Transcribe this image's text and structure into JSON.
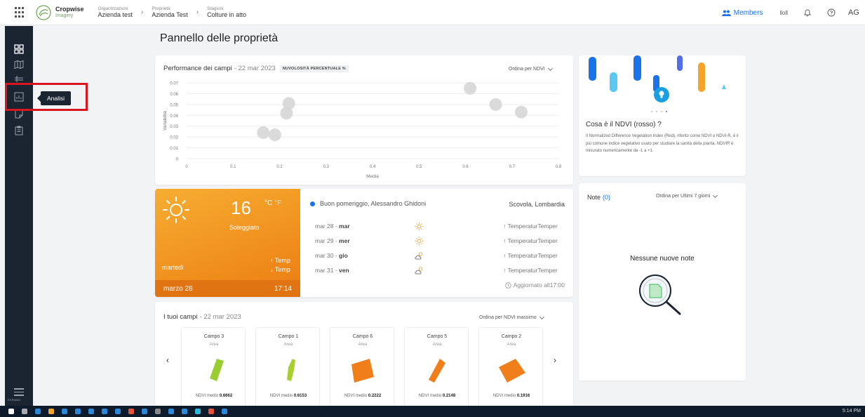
{
  "app": {
    "brand": "Cropwise",
    "product": "Imagery"
  },
  "breadcrumb": [
    {
      "key": "Organizzazioni",
      "value": "Azienda test"
    },
    {
      "key": "Proprietà",
      "value": "Azienda Test"
    },
    {
      "key": "Stagioni",
      "value": "Colture in atto"
    }
  ],
  "topbar": {
    "members": "Members",
    "user_text": "lloll",
    "avatar": "AG",
    "icons": [
      "apps-grid-icon",
      "members-icon",
      "bell-icon",
      "help-icon"
    ]
  },
  "sidebar": {
    "items": [
      "dashboard-icon",
      "map-icon",
      "layers-icon",
      "analysis-icon",
      "notes-icon",
      "reports-icon"
    ],
    "menu_label": "ESPANDI",
    "tooltip": "Analisi",
    "highlight_color": "#d9161f"
  },
  "page": {
    "title": "Pannello delle proprietà"
  },
  "performance": {
    "title": "Performance dei campi",
    "date": "- 22 mar 2023",
    "badge": "NUVOLOSITÀ PERCENTUALE %",
    "sort": "Ordina per NDVI"
  },
  "chart_data": {
    "type": "scatter",
    "xlabel": "Media",
    "ylabel": "Variabilità",
    "xlim": [
      0,
      0.8
    ],
    "ylim": [
      0,
      0.07
    ],
    "x_ticks": [
      "0",
      "0.1",
      "0.2",
      "0.3",
      "0.4",
      "0.5",
      "0.6",
      "0.7",
      "0.8"
    ],
    "y_ticks": [
      "0",
      "0.01",
      "0.02",
      "0.03",
      "0.04",
      "0.05",
      "0.06",
      "0.07"
    ],
    "points": [
      {
        "x": 0.165,
        "y": 0.024
      },
      {
        "x": 0.19,
        "y": 0.022
      },
      {
        "x": 0.215,
        "y": 0.042
      },
      {
        "x": 0.22,
        "y": 0.051
      },
      {
        "x": 0.61,
        "y": 0.065
      },
      {
        "x": 0.665,
        "y": 0.05
      },
      {
        "x": 0.72,
        "y": 0.043
      }
    ],
    "point_color": "#d6d6d6"
  },
  "weather": {
    "temp": "16",
    "unit_c": "°C",
    "unit_f": "°F",
    "condition": "Soleggiato",
    "day": "martedì",
    "high": "↑ Temp",
    "low": "↓ Temp",
    "date": "marzo 28",
    "time": "17:14",
    "greeting": "Buon pomeriggio, Alessandro Ghidoni",
    "location": "Scovola, Lombardia",
    "forecast": [
      {
        "date": "mar 28 -",
        "day": "mar",
        "icon": "sun-icon",
        "temp": "↑ TemperaturTemper"
      },
      {
        "date": "mar 29 -",
        "day": "mer",
        "icon": "sun-icon",
        "temp": "↑ TemperaturTemper"
      },
      {
        "date": "mar 30 -",
        "day": "gio",
        "icon": "cloud-sun-icon",
        "temp": "↑ TemperaturTemper"
      },
      {
        "date": "mar 31 -",
        "day": "ven",
        "icon": "cloud-sun-icon",
        "temp": "↑ TemperaturTemper"
      }
    ],
    "updated": "Aggiornato all17:00"
  },
  "fields": {
    "title": "I tuoi campi",
    "date": "- 22 mar 2023",
    "sort": "Ordina per NDVI massimo",
    "items": [
      {
        "name": "Campo 3",
        "area": "Area",
        "ndvi_label": "NDVI medio",
        "ndvi": "0.6662",
        "color": "#9acd32"
      },
      {
        "name": "Campo 1",
        "area": "Area",
        "ndvi_label": "NDVI medio",
        "ndvi": "0.6153",
        "color": "#a8cf2e"
      },
      {
        "name": "Campo 6",
        "area": "Area",
        "ndvi_label": "NDVI medio",
        "ndvi": "0.2222",
        "color": "#f07e1b"
      },
      {
        "name": "Campo 5",
        "area": "Area",
        "ndvi_label": "NDVI medio",
        "ndvi": "0.2148",
        "color": "#f07e1b"
      },
      {
        "name": "Campo 2",
        "area": "Area",
        "ndvi_label": "NDVI medio",
        "ndvi": "0.1916",
        "color": "#f07e1b"
      }
    ]
  },
  "info": {
    "title": "Cosa è il NDVI (rosso) ?",
    "body": "Il Normalized Difference Vegetation Index (Red), riferito come NDVI o NDVI-R, è il più comune indice vegetativo usato per studiare la sanità della pianta. NDVIR è misurato numericamente da -1 a +1."
  },
  "notes": {
    "title": "Note",
    "count": "(0)",
    "sort": "Ordina per Ultimi 7 giorni",
    "empty": "Nessune nuove note"
  },
  "taskbar": {
    "time": "5:14 PM"
  }
}
